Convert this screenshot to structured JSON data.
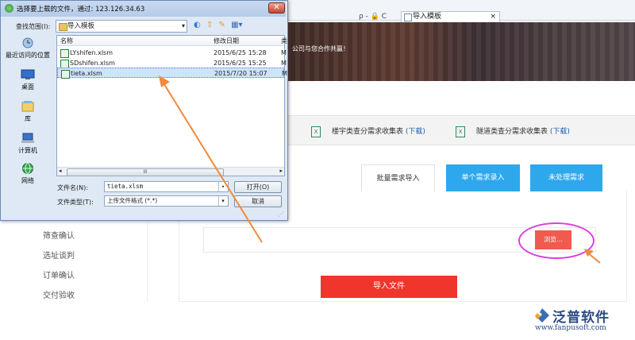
{
  "dialog": {
    "title": "选择要上载的文件，通过: 123.126.34.63",
    "close": "✕",
    "look_in_label": "查找范围(I):",
    "look_in_value": "导入模板",
    "nav_icons": [
      "◐",
      "⇧",
      "✎",
      "▦▾"
    ],
    "places": [
      "最近访问的位置",
      "桌面",
      "库",
      "计算机",
      "网络"
    ],
    "columns": [
      "名称",
      "修改日期",
      "类"
    ],
    "files": [
      {
        "name": "LYshifen.xlsm",
        "date": "2015/6/25 15:28",
        "type": "M"
      },
      {
        "name": "SDshifen.xlsm",
        "date": "2015/6/25 15:25",
        "type": "M"
      },
      {
        "name": "tieta.xlsm",
        "date": "2015/7/20 15:07",
        "type": "M"
      }
    ],
    "scroll_thumb": "III",
    "filename_label": "文件名(N):",
    "filename_value": "tieta.xlsm",
    "filetype_label": "文件类型(T):",
    "filetype_value": "上传文件格式 (*.*)",
    "open_label": "打开(O)",
    "cancel_label": "取消"
  },
  "browser": {
    "address_icons": "ρ - 🔒 C",
    "tab_title": "导入模板",
    "tab_close": "×"
  },
  "page": {
    "slogan": "公司与您合作共赢！",
    "downloads": [
      {
        "text": "楼宇类查分需求收集表",
        "link": "(下载)"
      },
      {
        "text": "隧道类查分需求收集表",
        "link": "(下载)"
      }
    ],
    "tabs": [
      "批量需求导入",
      "单个需求录入",
      "未处理需求"
    ],
    "browse_label": "浏览...",
    "import_label": "导入文件",
    "nav": [
      "筛查确认",
      "选址谈判",
      "订单确认",
      "交付验收"
    ]
  },
  "logo": {
    "name": "泛普软件",
    "url": "www.fanpusoft.com"
  },
  "colors": {
    "accent_blue": "#2ea8ec",
    "import_red": "#f0352c",
    "browse_red": "#f05a4f",
    "highlight": "#dd3ede",
    "arrow": "#f08a3c"
  }
}
